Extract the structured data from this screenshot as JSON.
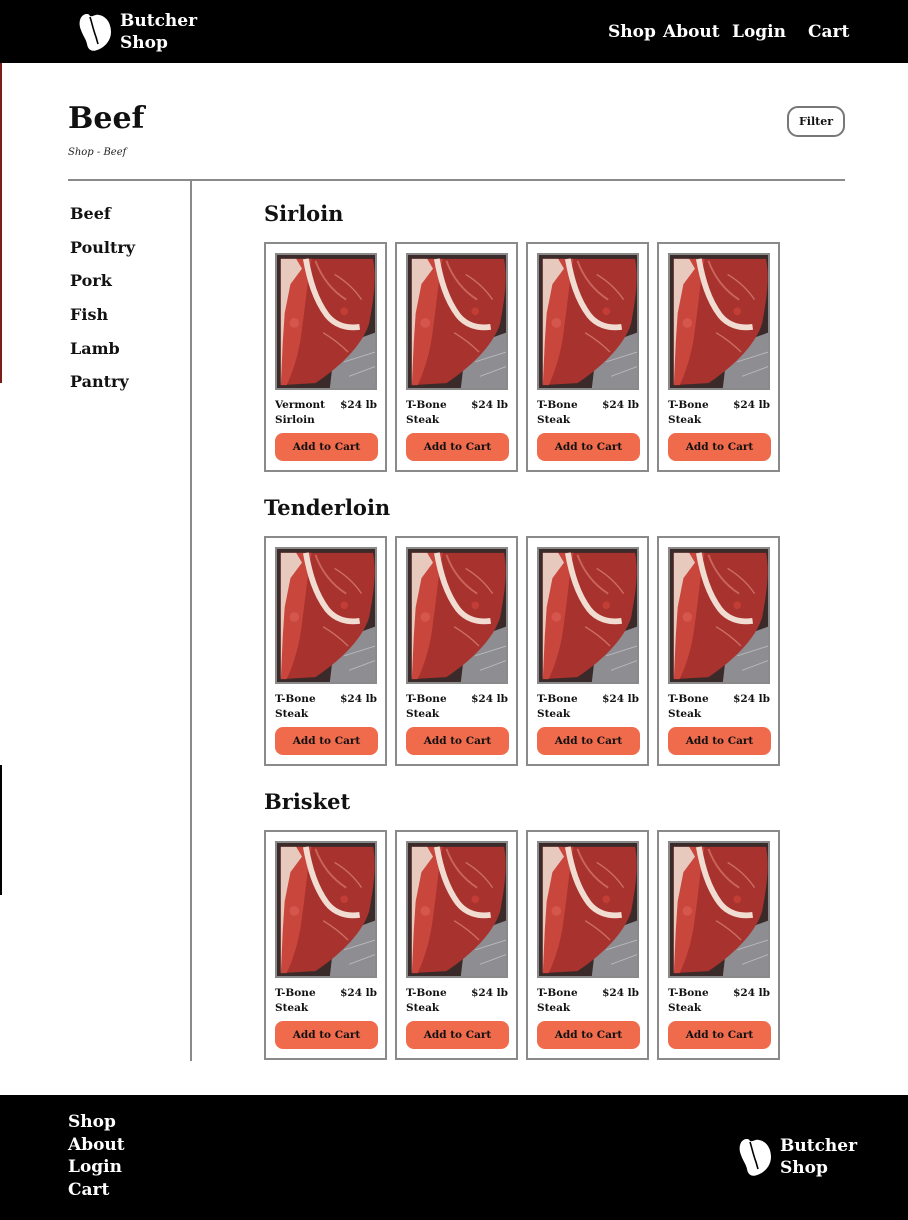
{
  "brand": {
    "line1": "Butcher",
    "line2": "Shop"
  },
  "nav": {
    "shop": "Shop",
    "about": "About",
    "login": "Login",
    "cart": "Cart"
  },
  "page": {
    "title": "Beef",
    "breadcrumb": "Shop - Beef",
    "filter_label": "Filter"
  },
  "sidebar": {
    "items": [
      "Beef",
      "Poultry",
      "Pork",
      "Fish",
      "Lamb",
      "Pantry"
    ]
  },
  "sections": [
    {
      "title": "Sirloin",
      "products": [
        {
          "name": "Vermont Sirloin",
          "price": "$24 lb",
          "button": "Add to Cart"
        },
        {
          "name": "T-Bone Steak",
          "price": "$24 lb",
          "button": "Add to Cart"
        },
        {
          "name": "T-Bone Steak",
          "price": "$24 lb",
          "button": "Add to Cart"
        },
        {
          "name": "T-Bone Steak",
          "price": "$24 lb",
          "button": "Add to Cart"
        }
      ]
    },
    {
      "title": "Tenderloin",
      "products": [
        {
          "name": "T-Bone Steak",
          "price": "$24 lb",
          "button": "Add to Cart"
        },
        {
          "name": "T-Bone Steak",
          "price": "$24 lb",
          "button": "Add to Cart"
        },
        {
          "name": "T-Bone Steak",
          "price": "$24 lb",
          "button": "Add to Cart"
        },
        {
          "name": "T-Bone Steak",
          "price": "$24 lb",
          "button": "Add to Cart"
        }
      ]
    },
    {
      "title": "Brisket",
      "products": [
        {
          "name": "T-Bone Steak",
          "price": "$24 lb",
          "button": "Add to Cart"
        },
        {
          "name": "T-Bone Steak",
          "price": "$24 lb",
          "button": "Add to Cart"
        },
        {
          "name": "T-Bone Steak",
          "price": "$24 lb",
          "button": "Add to Cart"
        },
        {
          "name": "T-Bone Steak",
          "price": "$24 lb",
          "button": "Add to Cart"
        }
      ]
    }
  ],
  "footer": {
    "links": [
      "Shop",
      "About",
      "Login",
      "Cart"
    ]
  },
  "colors": {
    "header_bg": "#000000",
    "accent": "#f06a4c",
    "border": "#8a8a8a",
    "meat": "#9b2a26"
  },
  "icons": {
    "logo": "t-bone-steak-icon",
    "product_image": "steak-photo"
  }
}
